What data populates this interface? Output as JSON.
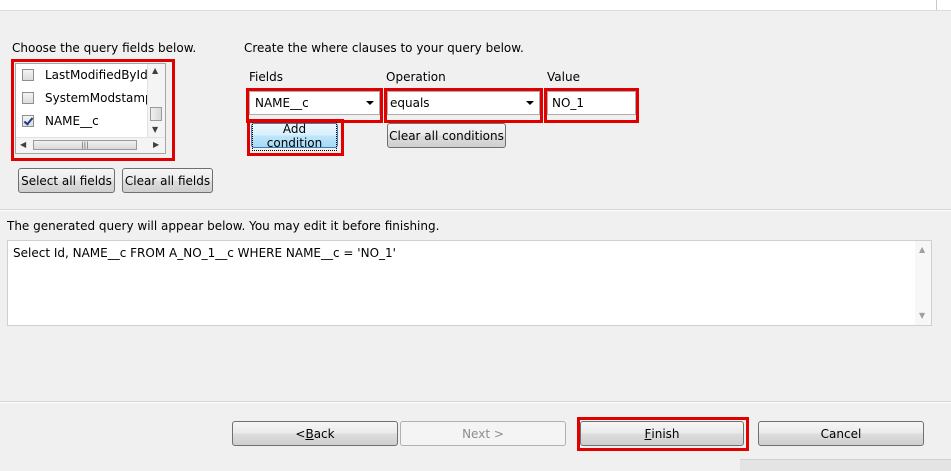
{
  "fields_panel": {
    "heading": "Choose the query fields below.",
    "items": [
      {
        "label": "LastModifiedById",
        "checked": false
      },
      {
        "label": "SystemModstamp",
        "checked": false
      },
      {
        "label": "NAME__c",
        "checked": true
      }
    ],
    "select_all_label": "Select all fields",
    "clear_all_label": "Clear all fields"
  },
  "where_panel": {
    "heading": "Create the where clauses to your query below.",
    "fields_label": "Fields",
    "operation_label": "Operation",
    "value_label": "Value",
    "field_selected": "NAME__c",
    "operation_selected": "equals",
    "value_text": "NO_1",
    "add_condition_label": "Add condition",
    "clear_conditions_label": "Clear all conditions"
  },
  "query_panel": {
    "heading": "The generated query will appear below.  You may edit it before finishing.",
    "query_text": "Select Id, NAME__c FROM A_NO_1__c WHERE NAME__c = 'NO_1'"
  },
  "footer": {
    "back_prefix": "< ",
    "back_mnemonic": "B",
    "back_rest": "ack",
    "next_label": "Next >",
    "finish_mnemonic": "F",
    "finish_rest": "inish",
    "cancel_label": "Cancel"
  },
  "colors": {
    "highlight_box": "#e00000",
    "window_bg": "#f0f0f0",
    "button_focus_border": "#3c7fb1"
  }
}
